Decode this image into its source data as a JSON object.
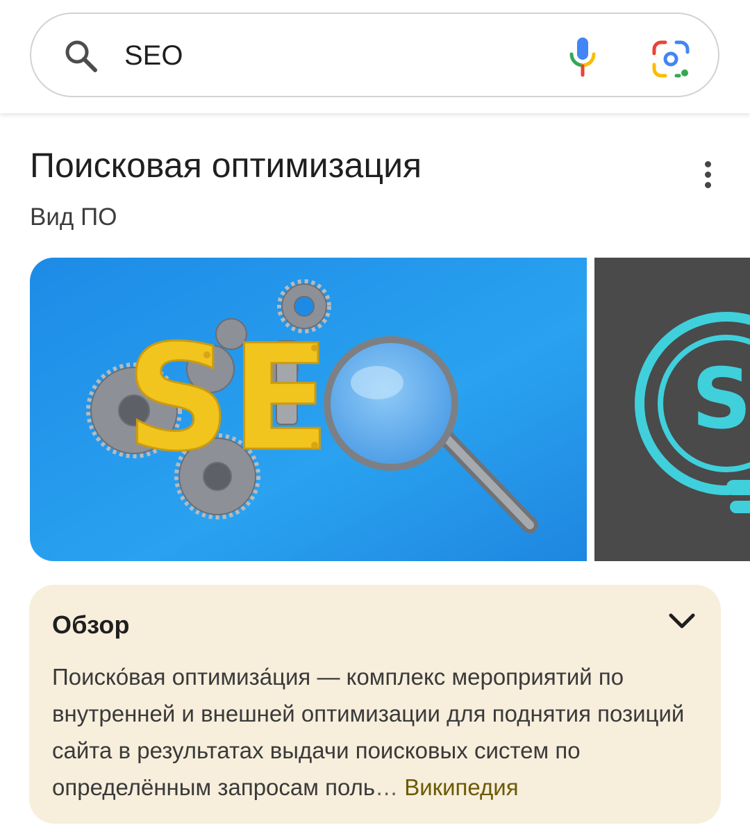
{
  "search": {
    "query": "SEO",
    "placeholder": ""
  },
  "knowledge_panel": {
    "title": "Поисковая оптимизация",
    "subtitle": "Вид ПО",
    "more_icon": "more-vert-icon",
    "images": [
      {
        "name": "seo-gears-magnifier-image",
        "letters": "SE"
      },
      {
        "name": "seo-lightbulb-image",
        "letters": "S"
      }
    ]
  },
  "overview": {
    "heading": "Обзор",
    "text_main": "Поиско́вая оптимиза́ция — комплекс мероприятий по внутренней и внешней оптимизации для поднятия позиций сайта в результатах выдачи поисковых систем по определённым запросам поль",
    "ellipsis": "… ",
    "source_link": "Википедия",
    "toggle_icon": "chevron-down-icon"
  },
  "colors": {
    "overview_bg": "#f7eedc",
    "link": "#6b5a05",
    "google_blue": "#4285F4",
    "google_red": "#EA4335",
    "google_yellow": "#FBBC04",
    "google_green": "#34A853"
  }
}
